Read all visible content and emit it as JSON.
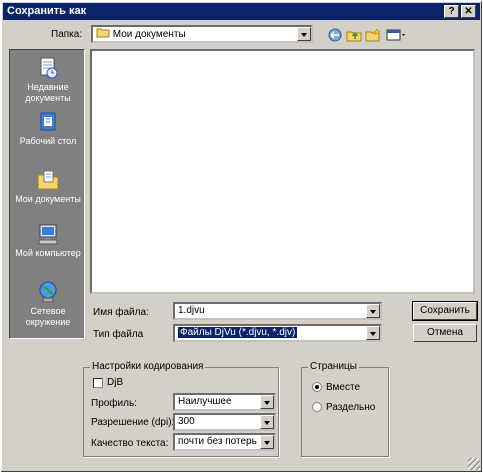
{
  "window": {
    "title": "Сохранить как",
    "help_btn": "?",
    "close_btn": "✕"
  },
  "toolbar": {
    "folder_label": "Папка:",
    "folder_value": "Мои документы"
  },
  "places": [
    {
      "label": "Недавние документы",
      "icon": "recent-documents-icon"
    },
    {
      "label": "Рабочий стол",
      "icon": "desktop-icon"
    },
    {
      "label": "Мои документы",
      "icon": "my-documents-icon"
    },
    {
      "label": "Мой компьютер",
      "icon": "my-computer-icon"
    },
    {
      "label": "Сетевое окружение",
      "icon": "network-icon"
    }
  ],
  "file": {
    "name_label": "Имя файла:",
    "name_value": "1.djvu",
    "type_label": "Тип файла",
    "type_value": "Файлы DjVu (*.djvu, *.djv)"
  },
  "buttons": {
    "save": "Сохранить",
    "cancel": "Отмена"
  },
  "encoding": {
    "title": "Настройки кодирования",
    "bw_label": "DjB",
    "profile_label": "Профиль:",
    "profile_value": "Наилучшее",
    "resolution_label": "Разрешение (dpi):",
    "resolution_value": "300",
    "quality_label": "Качество текста:",
    "quality_value": "почти без потерь"
  },
  "pages": {
    "title": "Страницы",
    "together_label": "Вместе",
    "separate_label": "Раздельно"
  }
}
